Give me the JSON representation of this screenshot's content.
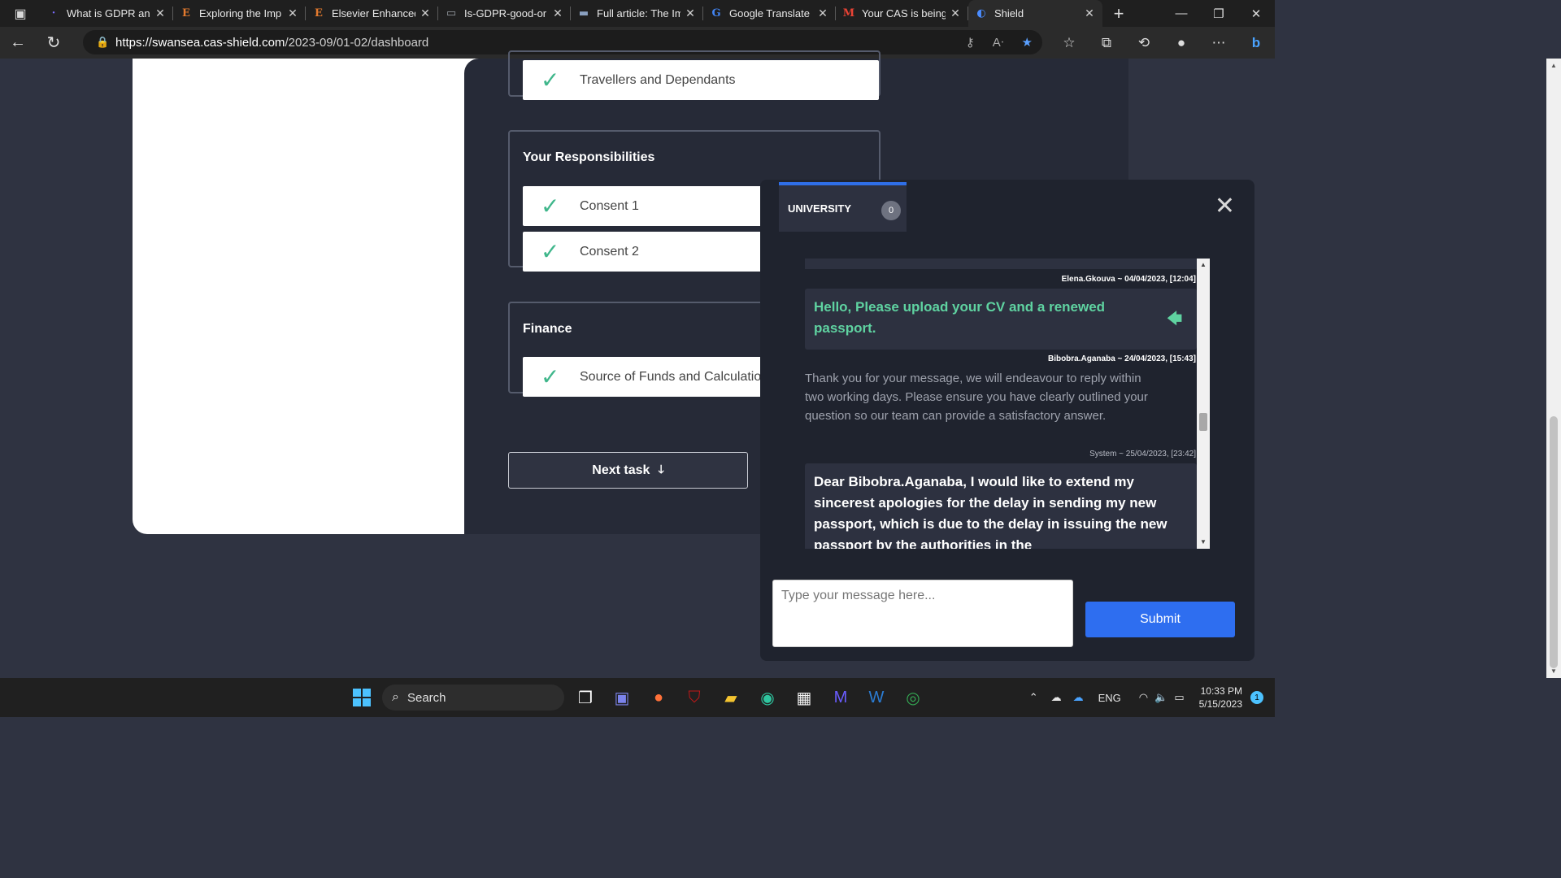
{
  "browser": {
    "tabs": [
      {
        "title": "What is GDPR and",
        "favicon": "·",
        "favicon_color": "#7a6cff"
      },
      {
        "title": "Exploring the Imp",
        "favicon": "E",
        "favicon_color": "#e37a2e"
      },
      {
        "title": "Elsevier Enhanced",
        "favicon": "E",
        "favicon_color": "#e37a2e"
      },
      {
        "title": "Is-GDPR-good-or",
        "favicon": "▭",
        "favicon_color": "#9aa0a6"
      },
      {
        "title": "Full article: The Im",
        "favicon": "▬",
        "favicon_color": "#8aa0c0"
      },
      {
        "title": "Google Translate",
        "favicon": "G",
        "favicon_color": "#4285f4"
      },
      {
        "title": "Your CAS is being",
        "favicon": "M",
        "favicon_color": "#ea4335"
      },
      {
        "title": "Shield",
        "favicon": "◐",
        "favicon_color": "#4a8cff"
      }
    ],
    "url_host": "https://swansea.cas-shield.com",
    "url_path": "/2023-09/01-02/dashboard"
  },
  "page": {
    "groups": [
      {
        "title": "",
        "tasks": [
          {
            "label": "Travellers and Dependants"
          }
        ]
      },
      {
        "title": "Your Responsibilities",
        "tasks": [
          {
            "label": "Consent 1"
          },
          {
            "label": "Consent 2"
          }
        ]
      },
      {
        "title": "Finance",
        "tasks": [
          {
            "label": "Source of Funds and Calculation"
          }
        ]
      }
    ],
    "next_task_label": "Next task"
  },
  "chat": {
    "tab_label": "UNIVERSITY",
    "tab_badge": "0",
    "messages": [
      {
        "meta": "Elena.Gkouva ~ 04/04/2023, [12:04]",
        "text": "Hello, Please upload your CV and a renewed passport."
      },
      {
        "meta": "Bibobra.Aganaba ~ 24/04/2023, [15:43]",
        "text": "Thank you for your message, we will endeavour to reply within two working days. Please ensure you have clearly outlined your question so our team can provide a satisfactory answer."
      },
      {
        "meta": "System ~ 25/04/2023, [23:42]",
        "text": "Dear Bibobra.Aganaba, I would like to extend my sincerest apologies for the delay in sending my new passport, which is due to the delay in issuing the new passport by the authorities in the"
      }
    ],
    "input_placeholder": "Type your message here...",
    "submit_label": "Submit"
  },
  "taskbar": {
    "search_label": "Search",
    "chat_badge": "1",
    "lang": "ENG",
    "time": "10:33 PM",
    "date": "5/15/2023",
    "notification_count": "1"
  },
  "colors": {
    "accent_blue": "#2e6ef0",
    "check_green": "#3fb68b",
    "message_green": "#5fd3a1",
    "page_bg": "#2f3341"
  }
}
